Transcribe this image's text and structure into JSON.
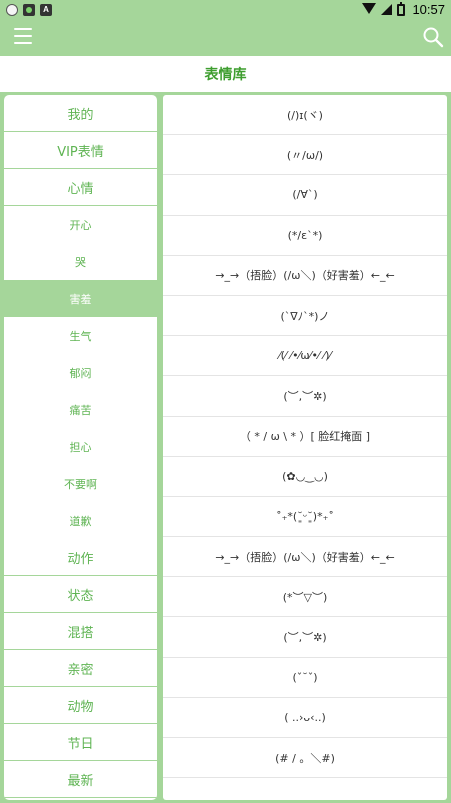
{
  "status_bar": {
    "time": "10:57",
    "icons": [
      "circle-icon",
      "camera-app-icon",
      "a-app-icon",
      "wifi-icon",
      "signal-icon",
      "battery-icon"
    ]
  },
  "app_bar": {
    "menu_icon": "menu-icon",
    "search_icon": "search-icon"
  },
  "page_title": "表情库",
  "colors": {
    "accent": "#a5d69a",
    "title_green": "#3e9e2f",
    "sidebar_text": "#5fb453"
  },
  "sidebar": {
    "items": [
      {
        "label": "我的",
        "level": "main"
      },
      {
        "label": "VIP表情",
        "level": "main"
      },
      {
        "label": "心情",
        "level": "main"
      },
      {
        "label": "开心",
        "level": "sub"
      },
      {
        "label": "哭",
        "level": "sub"
      },
      {
        "label": "害羞",
        "level": "sub",
        "active": true
      },
      {
        "label": "生气",
        "level": "sub"
      },
      {
        "label": "郁闷",
        "level": "sub"
      },
      {
        "label": "痛苦",
        "level": "sub"
      },
      {
        "label": "担心",
        "level": "sub"
      },
      {
        "label": "不要啊",
        "level": "sub"
      },
      {
        "label": "道歉",
        "level": "sub"
      },
      {
        "label": "动作",
        "level": "main"
      },
      {
        "label": "状态",
        "level": "main"
      },
      {
        "label": "混搭",
        "level": "main"
      },
      {
        "label": "亲密",
        "level": "main"
      },
      {
        "label": "动物",
        "level": "main"
      },
      {
        "label": "节日",
        "level": "main"
      },
      {
        "label": "最新",
        "level": "main"
      }
    ]
  },
  "emoticons": [
    "(/)ɪ(ヾ)",
    "(〃/ω/)",
    "(/∀`)",
    "(*/ε`*)",
    "→_→（捂脸）(/ω＼)（好害羞）←_←",
    "(`∇ﾉ`*)ノ",
    "⁄(⁄ ⁄•⁄ω⁄•⁄ ⁄)⁄",
    "(︶,︶✲)",
    "（ * / ω \\ * ）[ 脸红掩面 ]",
    "(✿◡‿◡)",
    "˚₊*(˘͈ᵕ˘͈)*₊˚",
    "→_→（捂脸）(/ω＼)（好害羞）←_←",
    "(*︶▽︶)",
    "(︶,︶✲)",
    "(ˇ˘ˇ)",
    "( ..›ᴗ‹..)",
    "(# / 。＼#)"
  ]
}
